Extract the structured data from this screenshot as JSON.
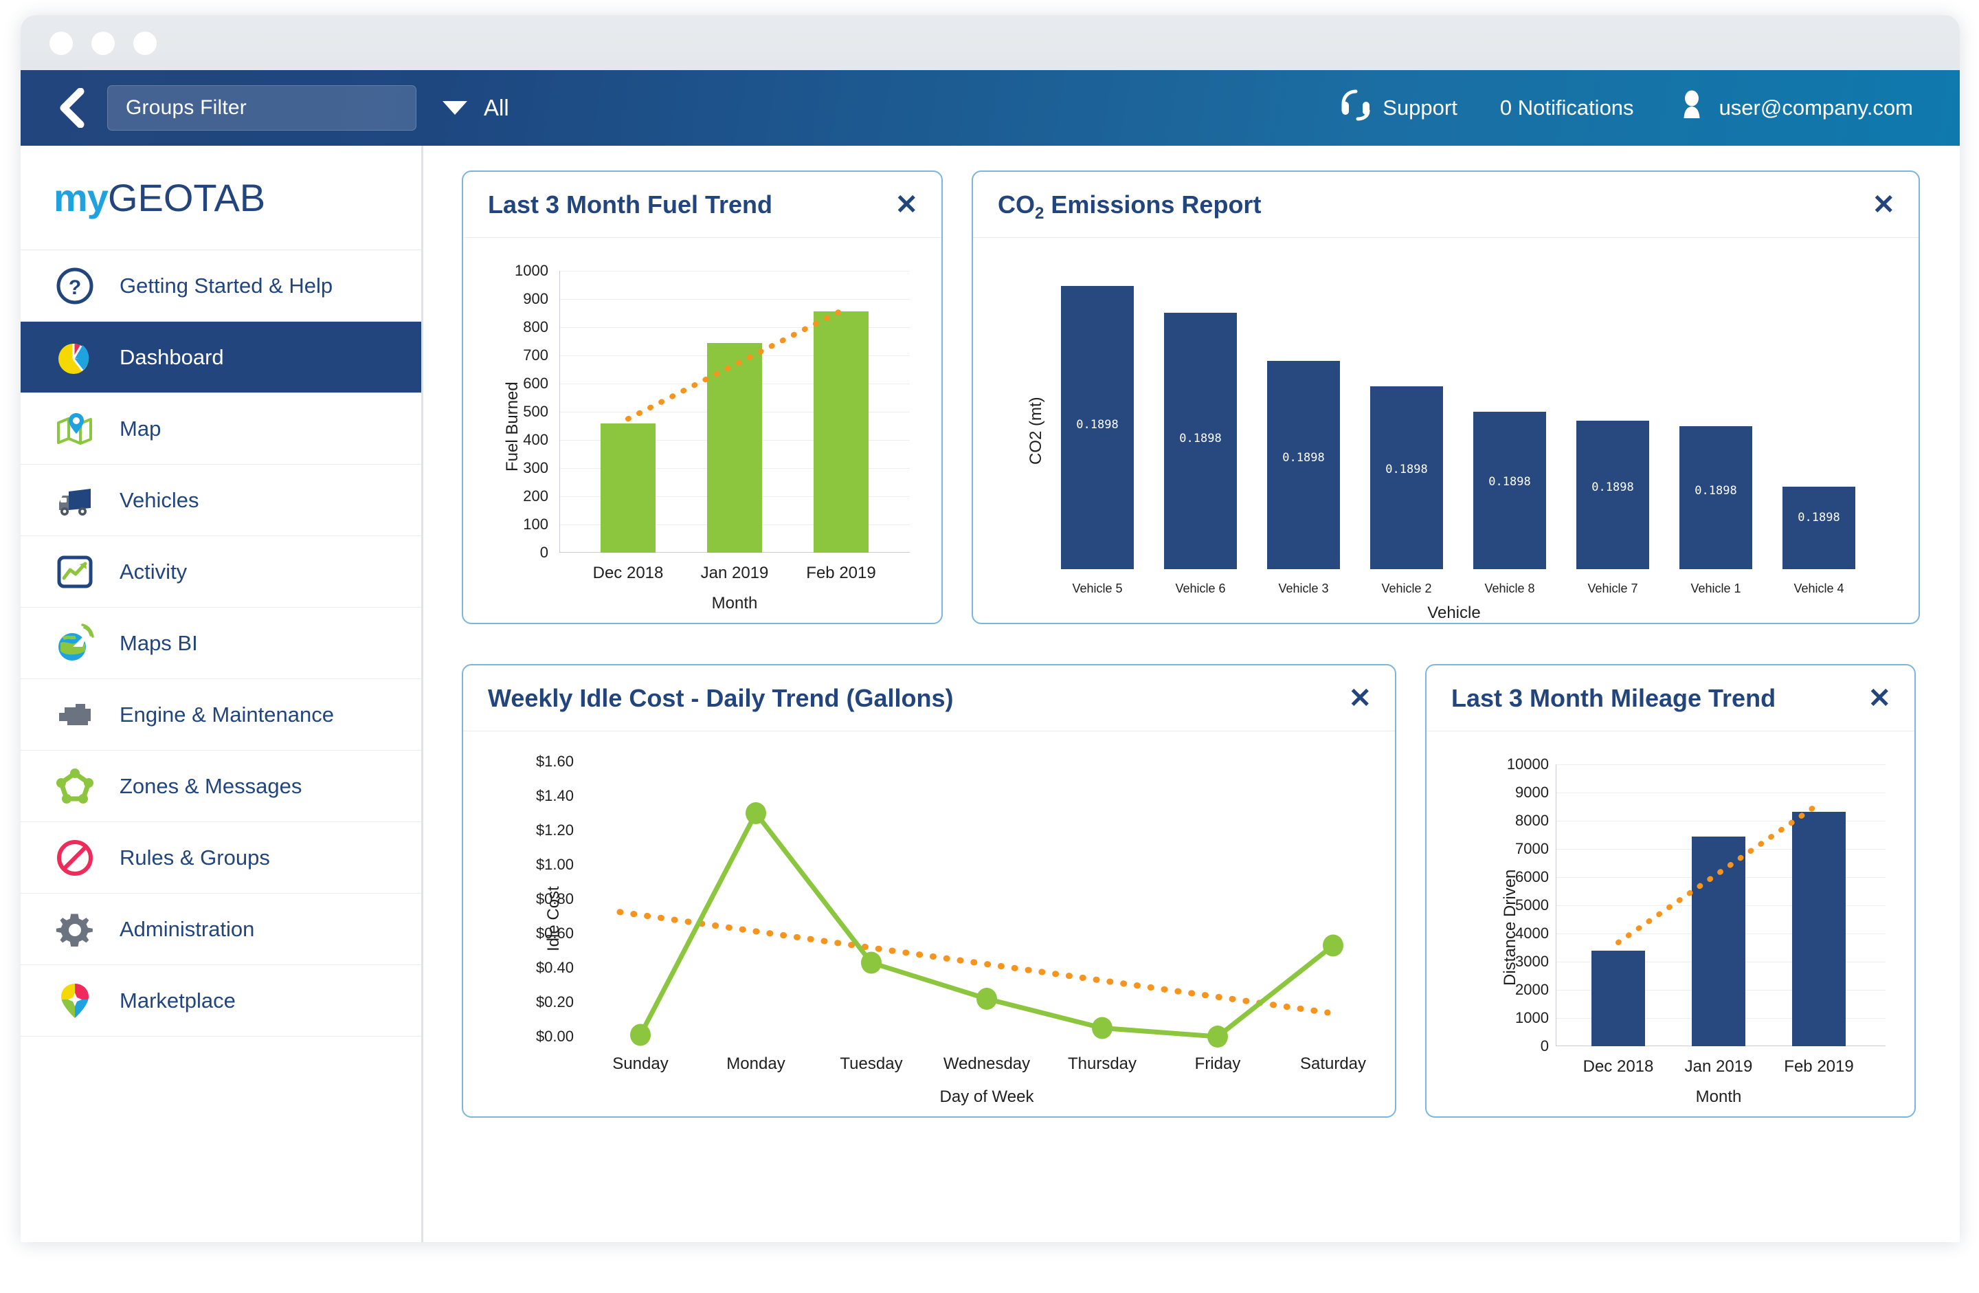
{
  "window": {
    "traffic_lights": [
      "close",
      "minimize",
      "maximize"
    ]
  },
  "topbar": {
    "back_label": "back",
    "groups_filter_value": "Groups Filter",
    "groups_filter_placeholder": "Groups Filter",
    "dropdown_value": "All",
    "support_label": "Support",
    "notifications_label": "0 Notifications",
    "user_email": "user@company.com"
  },
  "sidebar": {
    "logo_my": "my",
    "logo_geotab": "GEOTAB",
    "items": [
      {
        "label": "Getting Started & Help",
        "icon": "question-circle-icon",
        "active": false
      },
      {
        "label": "Dashboard",
        "icon": "pie-chart-icon",
        "active": true
      },
      {
        "label": "Map",
        "icon": "map-pin-icon",
        "active": false
      },
      {
        "label": "Vehicles",
        "icon": "truck-icon",
        "active": false
      },
      {
        "label": "Activity",
        "icon": "trend-up-icon",
        "active": false
      },
      {
        "label": "Maps BI",
        "icon": "globe-signal-icon",
        "active": false
      },
      {
        "label": "Engine & Maintenance",
        "icon": "engine-icon",
        "active": false
      },
      {
        "label": "Zones & Messages",
        "icon": "zone-nodes-icon",
        "active": false
      },
      {
        "label": "Rules & Groups",
        "icon": "no-entry-icon",
        "active": false
      },
      {
        "label": "Administration",
        "icon": "gear-icon",
        "active": false
      },
      {
        "label": "Marketplace",
        "icon": "marketplace-pin-icon",
        "active": false
      }
    ]
  },
  "colors": {
    "navy": "#23457d",
    "bar_navy": "#27497f",
    "green": "#8cc63e",
    "orange": "#f7941e",
    "card_border": "#7cb6de",
    "brand_cyan": "#1fa2e0"
  },
  "cards": [
    {
      "title": "Last 3 Month Fuel Trend",
      "close_label": "✕"
    },
    {
      "title": "CO2 Emissions Report",
      "title_prefix": "CO",
      "title_sub": "2",
      "title_rest": " Emissions Report",
      "close_label": "✕"
    },
    {
      "title": "Weekly Idle Cost - Daily Trend (Gallons)",
      "close_label": "✕"
    },
    {
      "title": "Last 3 Month Mileage Trend",
      "close_label": "✕"
    }
  ],
  "chart_data": [
    {
      "id": "fuel-trend",
      "type": "bar",
      "title": "Last 3 Month Fuel Trend",
      "categories": [
        "Dec 2018",
        "Jan 2019",
        "Feb 2019"
      ],
      "values": [
        458,
        745,
        857
      ],
      "xlabel": "Month",
      "ylabel": "Fuel Burned",
      "ylim": [
        0,
        1000
      ],
      "yticks": [
        0,
        100,
        200,
        300,
        400,
        500,
        600,
        700,
        800,
        900,
        1000
      ],
      "ytick_labels": [
        "0",
        "100",
        "200",
        "300",
        "400",
        "500",
        "600",
        "700",
        "800",
        "900",
        "1000"
      ],
      "grid": true,
      "legend": "none",
      "series_color": "#8cc63e",
      "trendline": {
        "type": "dotted-linear",
        "color": "#f7941e",
        "from": 475,
        "to": 858
      }
    },
    {
      "id": "co2-emissions",
      "type": "bar",
      "title": "CO2 Emissions Report",
      "categories": [
        "Vehicle 5",
        "Vehicle 6",
        "Vehicle 3",
        "Vehicle 2",
        "Vehicle 8",
        "Vehicle 7",
        "Vehicle 1",
        "Vehicle 4"
      ],
      "values": [
        1.0,
        0.905,
        0.735,
        0.645,
        0.555,
        0.525,
        0.505,
        0.29
      ],
      "bar_labels": [
        "0.1898",
        "0.1898",
        "0.1898",
        "0.1898",
        "0.1898",
        "0.1898",
        "0.1898",
        "0.1898"
      ],
      "xlabel": "Vehicle",
      "ylabel": "CO2 (mt)",
      "ylim": [
        0,
        1.05
      ],
      "yticks": [],
      "ytick_labels": [],
      "grid": false,
      "legend": "none",
      "series_color": "#27497f"
    },
    {
      "id": "weekly-idle-cost",
      "type": "line",
      "title": "Weekly Idle Cost - Daily Trend (Gallons)",
      "categories": [
        "Sunday",
        "Monday",
        "Tuesday",
        "Wednesday",
        "Thursday",
        "Friday",
        "Saturday"
      ],
      "values": [
        0.01,
        1.3,
        0.43,
        0.22,
        0.05,
        0.0,
        0.53
      ],
      "xlabel": "Day of Week",
      "ylabel": "Idle Cost",
      "ylim": [
        0,
        1.6
      ],
      "yticks": [
        0,
        0.2,
        0.4,
        0.6,
        0.8,
        1.0,
        1.2,
        1.4,
        1.6
      ],
      "ytick_labels": [
        "$0.00",
        "$0.20",
        "$0.40",
        "$0.60",
        "$0.80",
        "$1.00",
        "$1.20",
        "$1.40",
        "$1.60"
      ],
      "grid": false,
      "legend": "none",
      "series_color": "#8cc63e",
      "marker": "circle",
      "trendline": {
        "type": "dotted-linear",
        "color": "#f7941e",
        "from": 0.725,
        "to": 0.14
      }
    },
    {
      "id": "mileage-trend",
      "type": "bar",
      "title": "Last 3 Month Mileage Trend",
      "categories": [
        "Dec 2018",
        "Jan 2019",
        "Feb 2019"
      ],
      "values": [
        3380,
        7430,
        8320
      ],
      "xlabel": "Month",
      "ylabel": "Distance Driven",
      "ylim": [
        0,
        10000
      ],
      "yticks": [
        0,
        1000,
        2000,
        3000,
        4000,
        5000,
        6000,
        7000,
        8000,
        9000,
        10000
      ],
      "ytick_labels": [
        "0",
        "1000",
        "2000",
        "3000",
        "4000",
        "5000",
        "6000",
        "7000",
        "8000",
        "9000",
        "10000"
      ],
      "grid": true,
      "legend": "none",
      "series_color": "#27497f",
      "trendline": {
        "type": "dotted-linear",
        "color": "#f7941e",
        "from": 3680,
        "to": 8600
      }
    }
  ]
}
